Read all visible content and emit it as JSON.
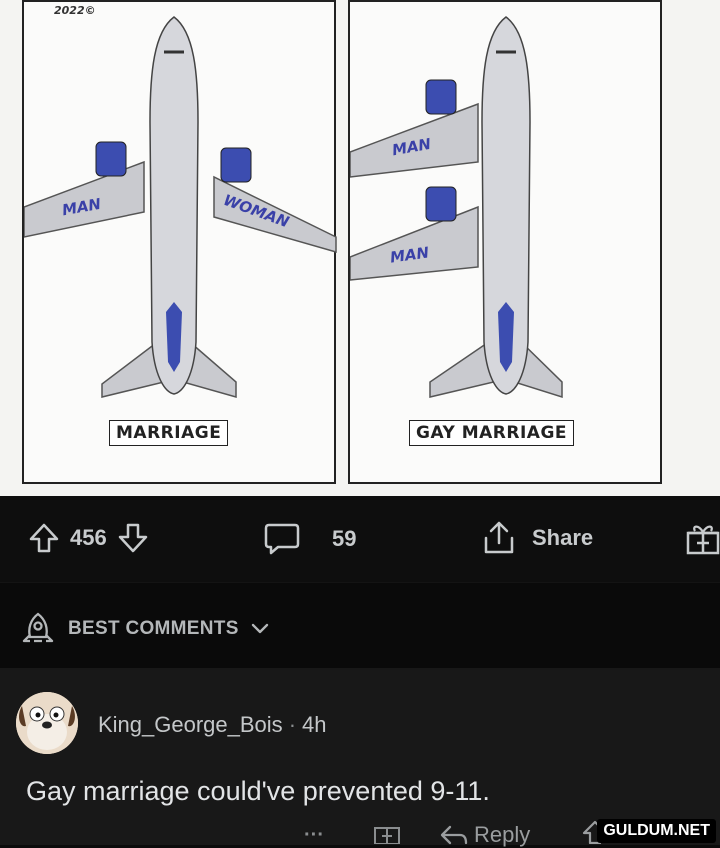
{
  "comic": {
    "credit": "2022©",
    "left_panel": {
      "left_wing_label": "MAN",
      "right_wing_label": "WOMAN",
      "caption": "MARRIAGE"
    },
    "right_panel": {
      "upper_wing_label": "MAN",
      "lower_wing_label": "MAN",
      "caption": "GAY MARRIAGE"
    }
  },
  "actions": {
    "upvote_icon": "arrow-up-icon",
    "score": "456",
    "downvote_icon": "arrow-down-icon",
    "comment_icon": "speech-bubble-icon",
    "comment_count": "59",
    "share_icon": "share-icon",
    "share_label": "Share",
    "award_icon": "gift-icon"
  },
  "sort": {
    "icon": "rocket-icon",
    "label": "BEST COMMENTS",
    "chevron": "chevron-down-icon"
  },
  "comment": {
    "author": "King_George_Bois",
    "separator": "·",
    "age": "4h",
    "body": "Gay marriage could've prevented 9-11.",
    "more_label": "···",
    "reply_label": "Reply"
  },
  "watermark": "GULDUM.NET",
  "colors": {
    "background": "#0b0b0b",
    "comment_bg": "#181818",
    "wing_label": "#3a41a8"
  }
}
